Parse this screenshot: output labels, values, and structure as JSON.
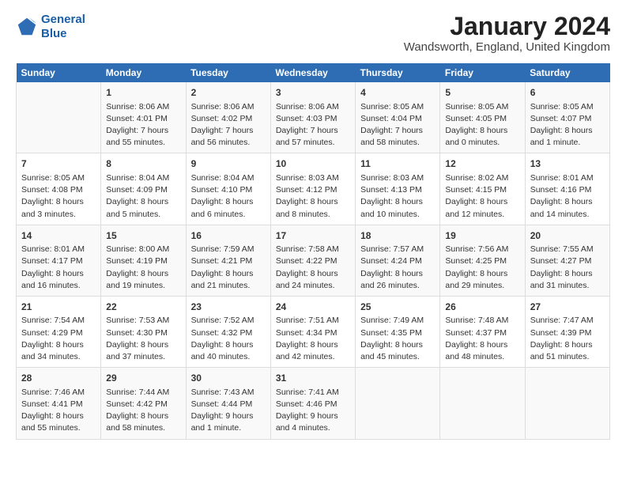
{
  "header": {
    "logo_line1": "General",
    "logo_line2": "Blue",
    "title": "January 2024",
    "subtitle": "Wandsworth, England, United Kingdom"
  },
  "days_of_week": [
    "Sunday",
    "Monday",
    "Tuesday",
    "Wednesday",
    "Thursday",
    "Friday",
    "Saturday"
  ],
  "weeks": [
    [
      {
        "num": "",
        "info": ""
      },
      {
        "num": "1",
        "info": "Sunrise: 8:06 AM\nSunset: 4:01 PM\nDaylight: 7 hours\nand 55 minutes."
      },
      {
        "num": "2",
        "info": "Sunrise: 8:06 AM\nSunset: 4:02 PM\nDaylight: 7 hours\nand 56 minutes."
      },
      {
        "num": "3",
        "info": "Sunrise: 8:06 AM\nSunset: 4:03 PM\nDaylight: 7 hours\nand 57 minutes."
      },
      {
        "num": "4",
        "info": "Sunrise: 8:05 AM\nSunset: 4:04 PM\nDaylight: 7 hours\nand 58 minutes."
      },
      {
        "num": "5",
        "info": "Sunrise: 8:05 AM\nSunset: 4:05 PM\nDaylight: 8 hours\nand 0 minutes."
      },
      {
        "num": "6",
        "info": "Sunrise: 8:05 AM\nSunset: 4:07 PM\nDaylight: 8 hours\nand 1 minute."
      }
    ],
    [
      {
        "num": "7",
        "info": "Sunrise: 8:05 AM\nSunset: 4:08 PM\nDaylight: 8 hours\nand 3 minutes."
      },
      {
        "num": "8",
        "info": "Sunrise: 8:04 AM\nSunset: 4:09 PM\nDaylight: 8 hours\nand 5 minutes."
      },
      {
        "num": "9",
        "info": "Sunrise: 8:04 AM\nSunset: 4:10 PM\nDaylight: 8 hours\nand 6 minutes."
      },
      {
        "num": "10",
        "info": "Sunrise: 8:03 AM\nSunset: 4:12 PM\nDaylight: 8 hours\nand 8 minutes."
      },
      {
        "num": "11",
        "info": "Sunrise: 8:03 AM\nSunset: 4:13 PM\nDaylight: 8 hours\nand 10 minutes."
      },
      {
        "num": "12",
        "info": "Sunrise: 8:02 AM\nSunset: 4:15 PM\nDaylight: 8 hours\nand 12 minutes."
      },
      {
        "num": "13",
        "info": "Sunrise: 8:01 AM\nSunset: 4:16 PM\nDaylight: 8 hours\nand 14 minutes."
      }
    ],
    [
      {
        "num": "14",
        "info": "Sunrise: 8:01 AM\nSunset: 4:17 PM\nDaylight: 8 hours\nand 16 minutes."
      },
      {
        "num": "15",
        "info": "Sunrise: 8:00 AM\nSunset: 4:19 PM\nDaylight: 8 hours\nand 19 minutes."
      },
      {
        "num": "16",
        "info": "Sunrise: 7:59 AM\nSunset: 4:21 PM\nDaylight: 8 hours\nand 21 minutes."
      },
      {
        "num": "17",
        "info": "Sunrise: 7:58 AM\nSunset: 4:22 PM\nDaylight: 8 hours\nand 24 minutes."
      },
      {
        "num": "18",
        "info": "Sunrise: 7:57 AM\nSunset: 4:24 PM\nDaylight: 8 hours\nand 26 minutes."
      },
      {
        "num": "19",
        "info": "Sunrise: 7:56 AM\nSunset: 4:25 PM\nDaylight: 8 hours\nand 29 minutes."
      },
      {
        "num": "20",
        "info": "Sunrise: 7:55 AM\nSunset: 4:27 PM\nDaylight: 8 hours\nand 31 minutes."
      }
    ],
    [
      {
        "num": "21",
        "info": "Sunrise: 7:54 AM\nSunset: 4:29 PM\nDaylight: 8 hours\nand 34 minutes."
      },
      {
        "num": "22",
        "info": "Sunrise: 7:53 AM\nSunset: 4:30 PM\nDaylight: 8 hours\nand 37 minutes."
      },
      {
        "num": "23",
        "info": "Sunrise: 7:52 AM\nSunset: 4:32 PM\nDaylight: 8 hours\nand 40 minutes."
      },
      {
        "num": "24",
        "info": "Sunrise: 7:51 AM\nSunset: 4:34 PM\nDaylight: 8 hours\nand 42 minutes."
      },
      {
        "num": "25",
        "info": "Sunrise: 7:49 AM\nSunset: 4:35 PM\nDaylight: 8 hours\nand 45 minutes."
      },
      {
        "num": "26",
        "info": "Sunrise: 7:48 AM\nSunset: 4:37 PM\nDaylight: 8 hours\nand 48 minutes."
      },
      {
        "num": "27",
        "info": "Sunrise: 7:47 AM\nSunset: 4:39 PM\nDaylight: 8 hours\nand 51 minutes."
      }
    ],
    [
      {
        "num": "28",
        "info": "Sunrise: 7:46 AM\nSunset: 4:41 PM\nDaylight: 8 hours\nand 55 minutes."
      },
      {
        "num": "29",
        "info": "Sunrise: 7:44 AM\nSunset: 4:42 PM\nDaylight: 8 hours\nand 58 minutes."
      },
      {
        "num": "30",
        "info": "Sunrise: 7:43 AM\nSunset: 4:44 PM\nDaylight: 9 hours\nand 1 minute."
      },
      {
        "num": "31",
        "info": "Sunrise: 7:41 AM\nSunset: 4:46 PM\nDaylight: 9 hours\nand 4 minutes."
      },
      {
        "num": "",
        "info": ""
      },
      {
        "num": "",
        "info": ""
      },
      {
        "num": "",
        "info": ""
      }
    ]
  ]
}
